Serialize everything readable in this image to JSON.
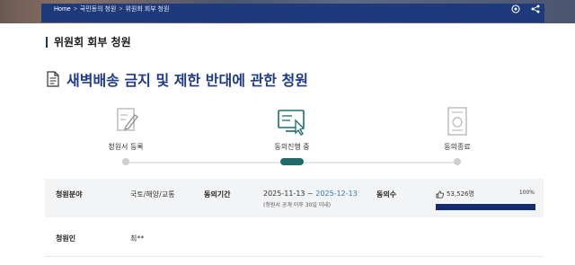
{
  "breadcrumb": {
    "home": "Home",
    "items": [
      "국민동의 청원",
      "위원회 회부 청원"
    ],
    "separator": ">"
  },
  "section_title": "위원회 회부 청원",
  "petition_title": "새벽배송 금지 및 제한 반대에 관한 청원",
  "steps": [
    {
      "label": "청원서 등록",
      "icon": "document-pen-icon",
      "active": false
    },
    {
      "label": "동의진행 중",
      "icon": "monitor-click-icon",
      "active": true
    },
    {
      "label": "동의종료",
      "icon": "certificate-icon",
      "active": false
    }
  ],
  "info": {
    "field_label": "청원분야",
    "field_value": "국토/해양/교통",
    "period_label": "동의기간",
    "period_start": "2025-11-13",
    "period_sep": " ~ ",
    "period_end": "2025-12-13",
    "period_note": "(청원서 공개 이후 30일 이내)",
    "agree_label": "동의수",
    "agree_count": "53,526명",
    "agree_percent_text": "100%",
    "agree_percent": 100
  },
  "petitioner": {
    "label": "청원인",
    "value": "최**"
  },
  "colors": {
    "brand_navy": "#1b3275",
    "active_teal": "#1f6b6b",
    "date_end": "#2a7bbf"
  }
}
